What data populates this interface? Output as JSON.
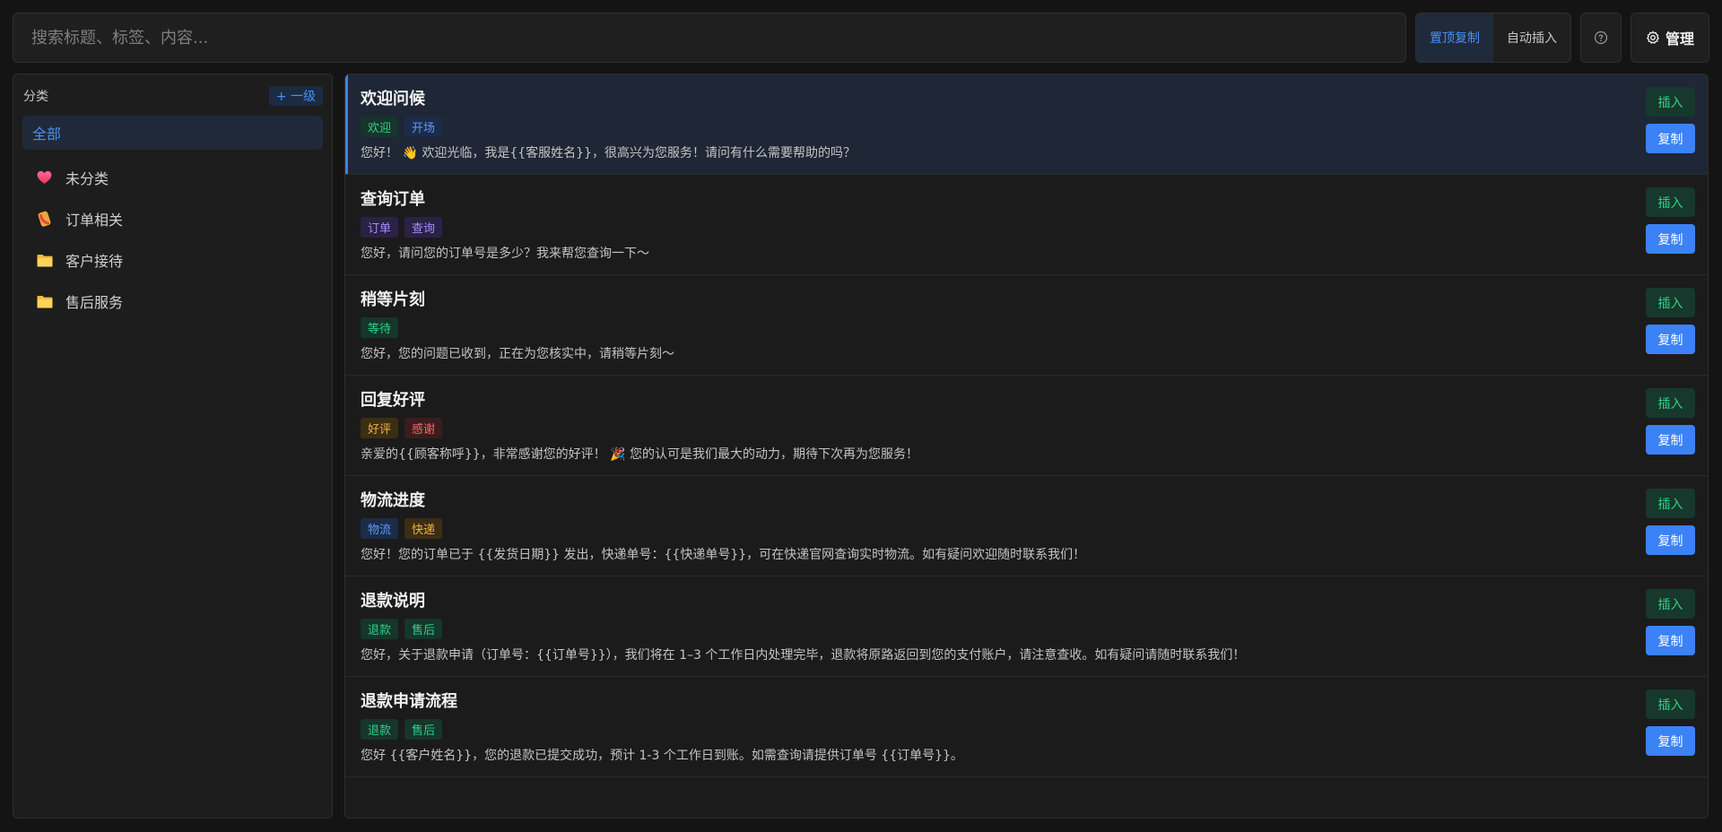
{
  "search": {
    "placeholder": "搜索标题、标签、内容..."
  },
  "modes": [
    {
      "label": "置顶复制",
      "active": true
    },
    {
      "label": "自动插入",
      "active": false
    }
  ],
  "help": {
    "icon": "question-circle-icon"
  },
  "manage": {
    "label": "管理",
    "icon": "gear-icon"
  },
  "sidebar": {
    "title": "分类",
    "add_label": "+ 一级",
    "all_label": "全部",
    "categories": [
      {
        "label": "未分类",
        "icon": "heart-icon"
      },
      {
        "label": "订单相关",
        "icon": "phone-icon"
      },
      {
        "label": "客户接待",
        "icon": "folder-icon"
      },
      {
        "label": "售后服务",
        "icon": "folder-icon"
      }
    ]
  },
  "colors": {
    "accent": "#3b82f6",
    "tag_green": "#2fd189",
    "tag_blue": "#5c9bf8",
    "tag_purple": "#a78bfa",
    "tag_yellow": "#f0b43a",
    "tag_red": "#f26b6b"
  },
  "actions": {
    "insert_label": "插入",
    "copy_label": "复制"
  },
  "items": [
    {
      "title": "欢迎问候",
      "tags": [
        {
          "label": "欢迎",
          "color": "green"
        },
        {
          "label": "开场",
          "color": "blue"
        }
      ],
      "content": "您好！ 👋 欢迎光临，我是{{客服姓名}}，很高兴为您服务！请问有什么需要帮助的吗？"
    },
    {
      "title": "查询订单",
      "tags": [
        {
          "label": "订单",
          "color": "purple"
        },
        {
          "label": "查询",
          "color": "purple"
        }
      ],
      "content": "您好，请问您的订单号是多少？我来帮您查询一下～"
    },
    {
      "title": "稍等片刻",
      "tags": [
        {
          "label": "等待",
          "color": "green"
        }
      ],
      "content": "您好，您的问题已收到，正在为您核实中，请稍等片刻～"
    },
    {
      "title": "回复好评",
      "tags": [
        {
          "label": "好评",
          "color": "yellow"
        },
        {
          "label": "感谢",
          "color": "red"
        }
      ],
      "content": "亲爱的{{顾客称呼}}，非常感谢您的好评！ 🎉 您的认可是我们最大的动力，期待下次再为您服务！"
    },
    {
      "title": "物流进度",
      "tags": [
        {
          "label": "物流",
          "color": "blue"
        },
        {
          "label": "快递",
          "color": "yellow"
        }
      ],
      "content": "您好！您的订单已于 {{发货日期}} 发出，快递单号：{{快递单号}}，可在快递官网查询实时物流。如有疑问欢迎随时联系我们！"
    },
    {
      "title": "退款说明",
      "tags": [
        {
          "label": "退款",
          "color": "green"
        },
        {
          "label": "售后",
          "color": "green"
        }
      ],
      "content": "您好，关于退款申请（订单号：{{订单号}}），我们将在 1–3 个工作日内处理完毕，退款将原路返回到您的支付账户，请注意查收。如有疑问请随时联系我们！"
    },
    {
      "title": "退款申请流程",
      "tags": [
        {
          "label": "退款",
          "color": "green"
        },
        {
          "label": "售后",
          "color": "green"
        }
      ],
      "content": "您好 {{客户姓名}}，您的退款已提交成功，预计 1-3 个工作日到账。如需查询请提供订单号 {{订单号}}。"
    }
  ]
}
